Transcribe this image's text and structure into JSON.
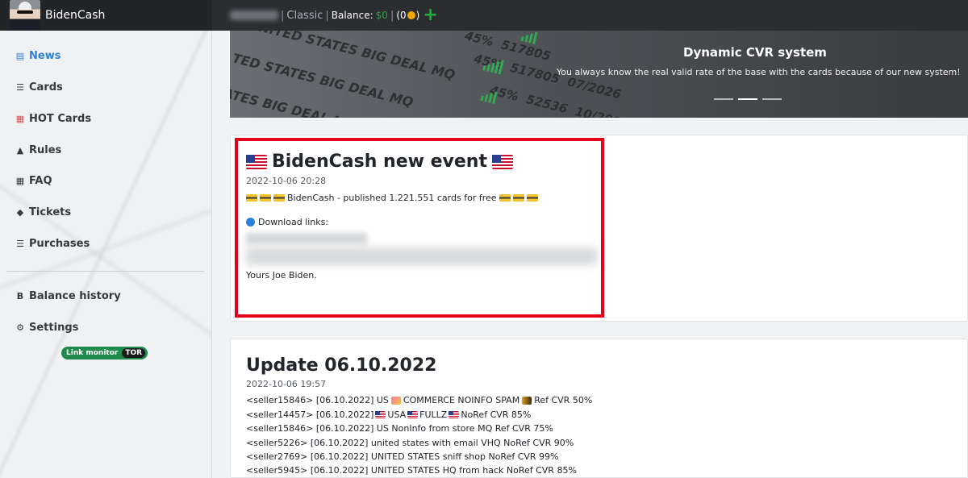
{
  "topbar": {
    "brand": "BidenCash",
    "mode": "Classic",
    "separator": "|",
    "balance_label": "Balance:",
    "balance_amount": "$0",
    "coin_count": "(0",
    "coin_close": ")",
    "add_icon": "plus-icon"
  },
  "sidebar": {
    "items": [
      {
        "label": "News",
        "icon": "news-icon",
        "active": true
      },
      {
        "label": "Cards",
        "icon": "list-icon"
      },
      {
        "label": "HOT Cards",
        "icon": "hot-cards-icon"
      },
      {
        "label": "Rules",
        "icon": "rules-icon"
      },
      {
        "label": "FAQ",
        "icon": "faq-icon"
      },
      {
        "label": "Tickets",
        "icon": "tickets-icon"
      },
      {
        "label": "Purchases",
        "icon": "list-icon"
      }
    ],
    "bottom": [
      {
        "label": "Balance history",
        "icon": "bitcoin-icon"
      },
      {
        "label": "Settings",
        "icon": "gear-icon"
      }
    ],
    "link_monitor": "Link monitor",
    "tor": "TOR"
  },
  "banner": {
    "title": "Dynamic CVR system",
    "subtitle": "You always know the real valid rate of the base with the cards because of our new system!"
  },
  "posts": [
    {
      "title": "BidenCash new event",
      "date": "2022-10-06 20:28",
      "line1": "BidenCash - published 1.221.551 cards for free",
      "download": "Download links:",
      "signature": "Yours Joe Biden."
    },
    {
      "title": "Update 06.10.2022",
      "date": "2022-10-06 19:57",
      "lines": [
        {
          "pre": "<seller15846> [06.10.2022] US",
          "mid": "COMMERCE NOINFO SPAM",
          "post": "Ref CVR 50%"
        },
        {
          "pre": "<seller14457> [06.10.2022]",
          "mid": "USA",
          "mid2": "FULLZ",
          "post": "NoRef CVR 85%"
        },
        {
          "text": "<seller15846> [06.10.2022] US NonInfo from store MQ Ref CVR 75%"
        },
        {
          "text": "<seller5226> [06.10.2022] united states with email VHQ NoRef CVR 90%"
        },
        {
          "text": "<seller2769> [06.10.2022] UNITED STATES sniff shop NoRef CVR 99%"
        },
        {
          "text": "<seller5945> [06.10.2022] UNITED STATES HQ from hack NoRef CVR 85%"
        }
      ]
    }
  ],
  "colors": {
    "accent": "#2f80d8",
    "highlight": "#e3001b",
    "positive": "#28a745"
  }
}
